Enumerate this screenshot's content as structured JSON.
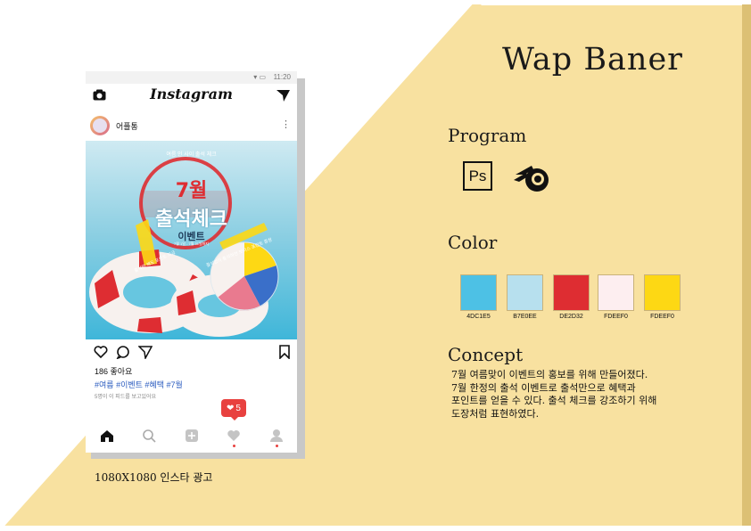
{
  "header": {
    "title": "Wap Baner"
  },
  "program": {
    "heading": "Program",
    "photoshop_label": "Ps"
  },
  "color": {
    "heading": "Color",
    "swatches": [
      {
        "hex": "#4DC1E5",
        "label": "4DC1E5"
      },
      {
        "hex": "#B7E0EE",
        "label": "B7E0EE"
      },
      {
        "hex": "#DE2D32",
        "label": "DE2D32"
      },
      {
        "hex": "#FDEEF0",
        "label": "FDEEF0"
      },
      {
        "hex": "#FDD814",
        "label": "FDEEF0"
      }
    ]
  },
  "concept": {
    "heading": "Concept",
    "text": "7월 여름맞이 이벤트의 홍보를 위해 만들어졌다.\n7월 한정의 출석 이벤트로 출석만으로 혜택과\n포인트를 얻을 수 있다. 출석 체크를 강조하기 위해\n도장처럼 표현하였다."
  },
  "caption": "1080X1080 인스타 광고",
  "phone": {
    "status_time": "11:20",
    "app_name": "Instagram",
    "username": "어플통",
    "likes": "186 좋아요",
    "tags": "#여름 #이벤트 #혜택 #7월",
    "comments": "5명이 이 피드를 보고있어요",
    "notification_count": "5",
    "post": {
      "top_text": "여름 인 사이 출석 체크",
      "month": "7월",
      "headline": "출석체크",
      "subline": "이벤트",
      "date": "7월 1일 - 7월 31일까지",
      "left_text": "출석만 해도 포인트 지급",
      "right_text": "결석없이 출석하면 보너스 포인트 증정",
      "colors": {
        "sky": "#4DC1E5",
        "light": "#B7E0EE",
        "red": "#DE2D32",
        "yellow": "#FDD814"
      }
    }
  },
  "background": {
    "accent": "#F8E1A0",
    "accent_dark": "#DCC074"
  }
}
